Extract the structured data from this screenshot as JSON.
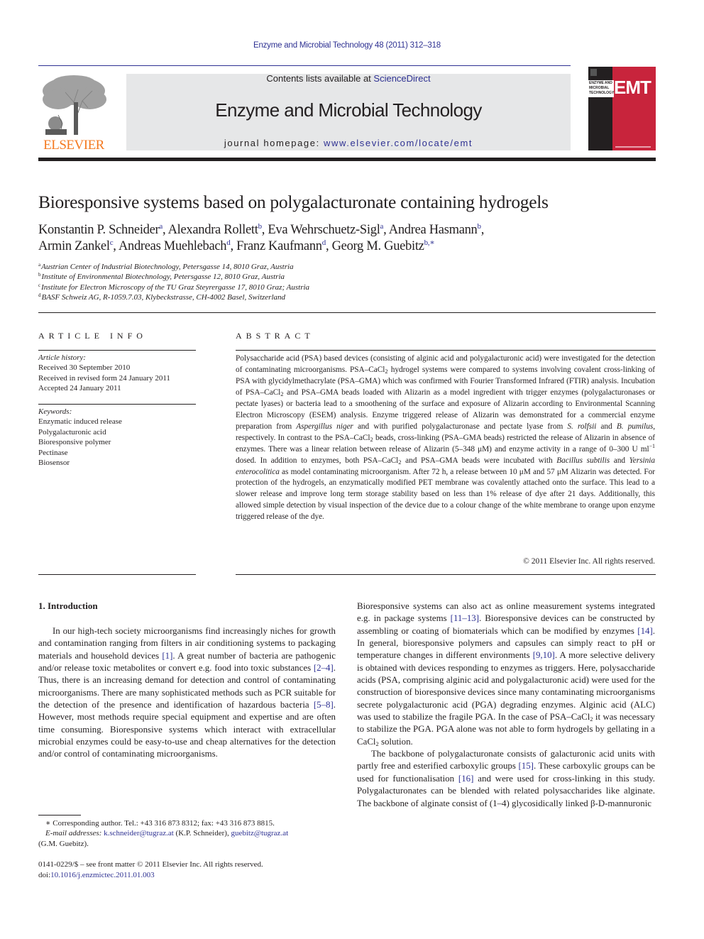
{
  "header": {
    "journal_citation": "Enzyme and Microbial Technology 48 (2011) 312–318",
    "contents_prefix": "Contents lists available at ",
    "contents_link": "ScienceDirect",
    "journal_name": "Enzyme and Microbial Technology",
    "homepage_prefix": "journal homepage: ",
    "homepage_link": "www.elsevier.com/locate/emt",
    "publisher_logo_text": "ELSEVIER",
    "cover": {
      "title_lines": [
        "ENZYME AND",
        "MICROBIAL",
        "TECHNOLOGY"
      ],
      "acronym": "EMT",
      "accent_color": "#c8243c"
    },
    "colors": {
      "link": "#2e3192",
      "publisher": "#f47920",
      "masthead_bg": "#e6e7e8"
    }
  },
  "article": {
    "title": "Bioresponsive systems based on polygalacturonate containing hydrogels",
    "authors": [
      {
        "name": "Konstantin P. Schneider",
        "aff": "a"
      },
      {
        "name": "Alexandra Rollett",
        "aff": "b"
      },
      {
        "name": "Eva Wehrschuetz-Sigl",
        "aff": "a"
      },
      {
        "name": "Andrea Hasmann",
        "aff": "b"
      },
      {
        "name": "Armin Zankel",
        "aff": "c"
      },
      {
        "name": "Andreas Muehlebach",
        "aff": "d"
      },
      {
        "name": "Franz Kaufmann",
        "aff": "d"
      },
      {
        "name": "Georg M. Guebitz",
        "aff": "b,∗"
      }
    ],
    "affiliations": [
      {
        "key": "a",
        "text": "Austrian Center of Industrial Biotechnology, Petersgasse 14, 8010 Graz, Austria"
      },
      {
        "key": "b",
        "text": "Institute of Environmental Biotechnology, Petersgasse 12, 8010 Graz, Austria"
      },
      {
        "key": "c",
        "text": "Institute for Electron Microscopy of the TU Graz Steyrergasse 17, 8010 Graz; Austria"
      },
      {
        "key": "d",
        "text": "BASF Schweiz AG, R-1059.7.03, Klybeckstrasse, CH-4002 Basel, Switzerland"
      }
    ]
  },
  "article_info": {
    "heading": "ARTICLE INFO",
    "history_label": "Article history:",
    "history": [
      "Received 30 September 2010",
      "Received in revised form 24 January 2011",
      "Accepted 24 January 2011"
    ],
    "keywords_label": "Keywords:",
    "keywords": [
      "Enzymatic induced release",
      "Polygalacturonic acid",
      "Bioresponsive polymer",
      "Pectinase",
      "Biosensor"
    ]
  },
  "abstract": {
    "heading": "ABSTRACT",
    "segments": {
      "s1": "Polysaccharide acid (PSA) based devices (consisting of alginic acid and polygalacturonic acid) were investigated for the detection of contaminating microorganisms. PSA–CaCl",
      "s2": " hydrogel systems were compared to systems involving covalent cross-linking of PSA with glycidylmethacrylate (PSA–GMA) which was confirmed with Fourier Transformed Infrared (FTIR) analysis. Incubation of PSA–CaCl",
      "s3": " and PSA–GMA beads loaded with Alizarin as a model ingredient with trigger enzymes (polygalacturonases or pectate lyases) or bacteria lead to a smoothening of the surface and exposure of Alizarin according to Environmental Scanning Electron Microscopy (ESEM) analysis. Enzyme triggered release of Alizarin was demonstrated for a commercial enzyme preparation from ",
      "i1": "Aspergillus niger",
      "s4": " and with purified polygalacturonase and pectate lyase from ",
      "i2": "S. rolfsii",
      "s5": " and ",
      "i3": "B. pumilus",
      "s6": ", respectively. In contrast to the PSA–CaCl",
      "s7": " beads, cross-linking (PSA–GMA beads) restricted the release of Alizarin in absence of enzymes. There was a linear relation between release of Alizarin (5–348 μM) and enzyme activity in a range of 0–300 U ml",
      "sup1": "−1",
      "s8": " dosed. In addition to enzymes, both PSA–CaCl",
      "s9": " and PSA–GMA beads were incubated with ",
      "i4": "Bacillus subtilis",
      "s10": " and ",
      "i5": "Yersinia enterocolitica",
      "s11": " as model contaminating microorganism. After 72 h, a release between 10 μM and 57 μM Alizarin was detected. For protection of the hydrogels, an enzymatically modified PET membrane was covalently attached onto the surface. This lead to a slower release and improve long term storage stability based on less than 1% release of dye after 21 days. Additionally, this allowed simple detection by visual inspection of the device due to a colour change of the white membrane to orange upon enzyme triggered release of the dye.",
      "sub2": "2"
    },
    "copyright": "© 2011 Elsevier Inc. All rights reserved."
  },
  "introduction": {
    "heading": "1.  Introduction",
    "left": {
      "t1": "In our high-tech society microorganisms find increasingly niches for growth and contamination ranging from filters in air conditioning systems to packaging materials and household devices ",
      "c1": "[1]",
      "t2": ". A great number of bacteria are pathogenic and/or release toxic metabolites or convert e.g. food into toxic substances ",
      "c2": "[2–4]",
      "t3": ". Thus, there is an increasing demand for detection and control of contaminating microorganisms. There are many sophisticated methods such as PCR suitable for the detection of the presence and identification of hazardous bacteria ",
      "c3": "[5–8]",
      "t4": ". However, most methods require special equipment and expertise and are often time consuming. Bioresponsive systems which interact with extracellular microbial enzymes could be easy-to-use and cheap alternatives for the detection and/or control of contaminating microorganisms."
    },
    "right_p1": {
      "t1": "Bioresponsive systems can also act as online measurement systems integrated e.g. in package systems ",
      "c1": "[11–13]",
      "t2": ". Bioresponsive devices can be constructed by assembling or coating of biomaterials which can be modified by enzymes ",
      "c2": "[14]",
      "t3": ". In general, bioresponsive polymers and capsules can simply react to pH or temperature changes in different environments ",
      "c3": "[9,10]",
      "t4": ". A more selective delivery is obtained with devices responding to enzymes as triggers. Here, polysaccharide acids (PSA, comprising alginic acid and polygalacturonic acid) were used for the construction of bioresponsive devices since many contaminating microorganisms secrete polygalacturonic acid (PGA) degrading enzymes. Alginic acid (ALC) was used to stabilize the fragile PGA. In the case of PSA–CaCl",
      "t5": " it was necessary to stabilize the PGA. PGA alone was not able to form hydrogels by gellating in a CaCl",
      "t6": " solution.",
      "sub": "2"
    },
    "right_p2": {
      "t1": "The backbone of polygalacturonate consists of galacturonic acid units with partly free and esterified carboxylic groups ",
      "c1": "[15]",
      "t2": ". These carboxylic groups can be used for functionalisation ",
      "c2": "[16]",
      "t3": " and were used for cross-linking in this study. Polygalacturonates can be blended with related polysaccharides like alginate. The backbone of alginate consist of (1–4) glycosidically linked β-D-mannuronic"
    }
  },
  "footnotes": {
    "corresponding": "∗ Corresponding author. Tel.: +43 316 873 8312; fax: +43 316 873 8815.",
    "email_label": "E-mail addresses:",
    "email1": "k.schneider@tugraz.at",
    "email1_owner": " (K.P. Schneider), ",
    "email2": "guebitz@tugraz.at",
    "email2_owner": "(G.M. Guebitz).",
    "front_matter": "0141-0229/$ – see front matter © 2011 Elsevier Inc. All rights reserved.",
    "doi_label": "doi:",
    "doi": "10.1016/j.enzmictec.2011.01.003"
  }
}
